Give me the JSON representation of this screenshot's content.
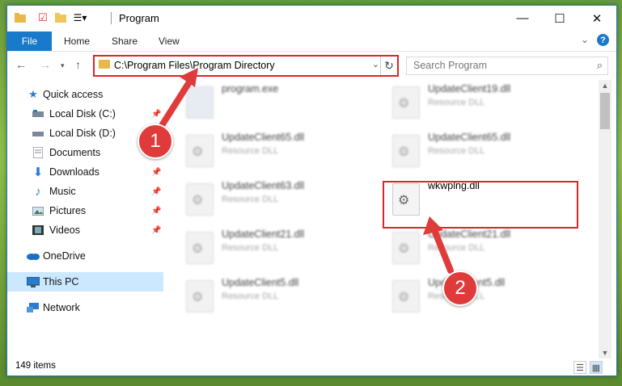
{
  "window": {
    "title": "Program",
    "controls": {
      "minimize": "—",
      "maximize": "☐",
      "close": "✕"
    }
  },
  "ribbon": {
    "tabs": [
      {
        "label": "File"
      },
      {
        "label": "Home"
      },
      {
        "label": "Share"
      },
      {
        "label": "View"
      }
    ],
    "expand_glyph": "⌄",
    "help_glyph": "?"
  },
  "navigation": {
    "address": "C:\\Program Files\\Program Directory",
    "search_placeholder": "Search Program"
  },
  "sidebar": {
    "items": [
      {
        "label": "Quick access",
        "icon": "star-icon"
      },
      {
        "label": "Local Disk (C:)",
        "icon": "drive-icon",
        "pinned": true
      },
      {
        "label": "Local Disk (D:)",
        "icon": "drive-icon",
        "pinned": true
      },
      {
        "label": "Documents",
        "icon": "documents-icon",
        "pinned": true
      },
      {
        "label": "Downloads",
        "icon": "download-icon",
        "pinned": true
      },
      {
        "label": "Music",
        "icon": "music-icon",
        "pinned": true
      },
      {
        "label": "Pictures",
        "icon": "pictures-icon",
        "pinned": true
      },
      {
        "label": "Videos",
        "icon": "videos-icon",
        "pinned": true
      },
      {
        "label": "OneDrive",
        "icon": "cloud-icon"
      },
      {
        "label": "This PC",
        "icon": "computer-icon",
        "selected": true
      },
      {
        "label": "Network",
        "icon": "network-icon"
      }
    ]
  },
  "files": [
    {
      "name": "program.exe",
      "desc": ""
    },
    {
      "name": "UpdateClient19.dll",
      "desc": "Resource DLL"
    },
    {
      "name": "UpdateClient65.dll",
      "desc": "Resource DLL"
    },
    {
      "name": "UpdateClient65.dll",
      "desc": "Resource DLL"
    },
    {
      "name": "UpdateClient63.dll",
      "desc": "Resource DLL"
    },
    {
      "name": "wkwplng.dll",
      "desc": ""
    },
    {
      "name": "UpdateClient21.dll",
      "desc": "Resource DLL"
    },
    {
      "name": "UpdateClient21.dll",
      "desc": "Resource DLL"
    },
    {
      "name": "UpdateClient5.dll",
      "desc": "Resource DLL"
    },
    {
      "name": "UpdateClient5.dll",
      "desc": "Resource DLL"
    }
  ],
  "annotations": {
    "step1": "1",
    "step2": "2"
  },
  "status": {
    "item_count": "149 items"
  },
  "colors": {
    "accent": "#1979ca",
    "highlight": "#d9262b",
    "badge": "#e03b3b"
  }
}
